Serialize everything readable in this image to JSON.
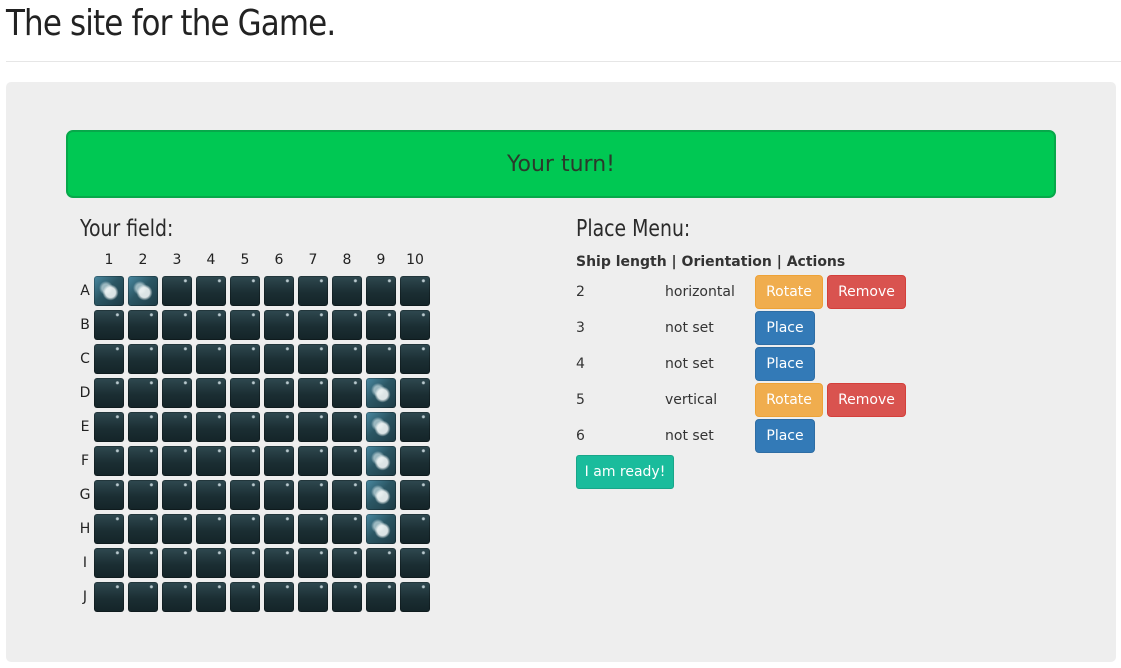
{
  "header": {
    "title": "The site for the Game."
  },
  "status": {
    "banner": "Your turn!"
  },
  "field": {
    "title": "Your field:",
    "columns": [
      "1",
      "2",
      "3",
      "4",
      "5",
      "6",
      "7",
      "8",
      "9",
      "10"
    ],
    "rows": [
      "A",
      "B",
      "C",
      "D",
      "E",
      "F",
      "G",
      "H",
      "I",
      "J"
    ],
    "ship_cells": [
      "A1",
      "A2",
      "D9",
      "E9",
      "F9",
      "G9",
      "H9"
    ]
  },
  "menu": {
    "title": "Place Menu:",
    "header": "Ship length | Orientation | Actions",
    "ships": [
      {
        "length": "2",
        "orientation": "horizontal",
        "actions": [
          "Rotate",
          "Remove"
        ]
      },
      {
        "length": "3",
        "orientation": "not set",
        "actions": [
          "Place"
        ]
      },
      {
        "length": "4",
        "orientation": "not set",
        "actions": [
          "Place"
        ]
      },
      {
        "length": "5",
        "orientation": "vertical",
        "actions": [
          "Rotate",
          "Remove"
        ]
      },
      {
        "length": "6",
        "orientation": "not set",
        "actions": [
          "Place"
        ]
      }
    ],
    "ready_label": "I am ready!"
  },
  "colors": {
    "banner": "#00c853",
    "rotate": "#f0ad4e",
    "remove": "#d9534f",
    "place": "#337ab7",
    "ready": "#1abc9c"
  }
}
